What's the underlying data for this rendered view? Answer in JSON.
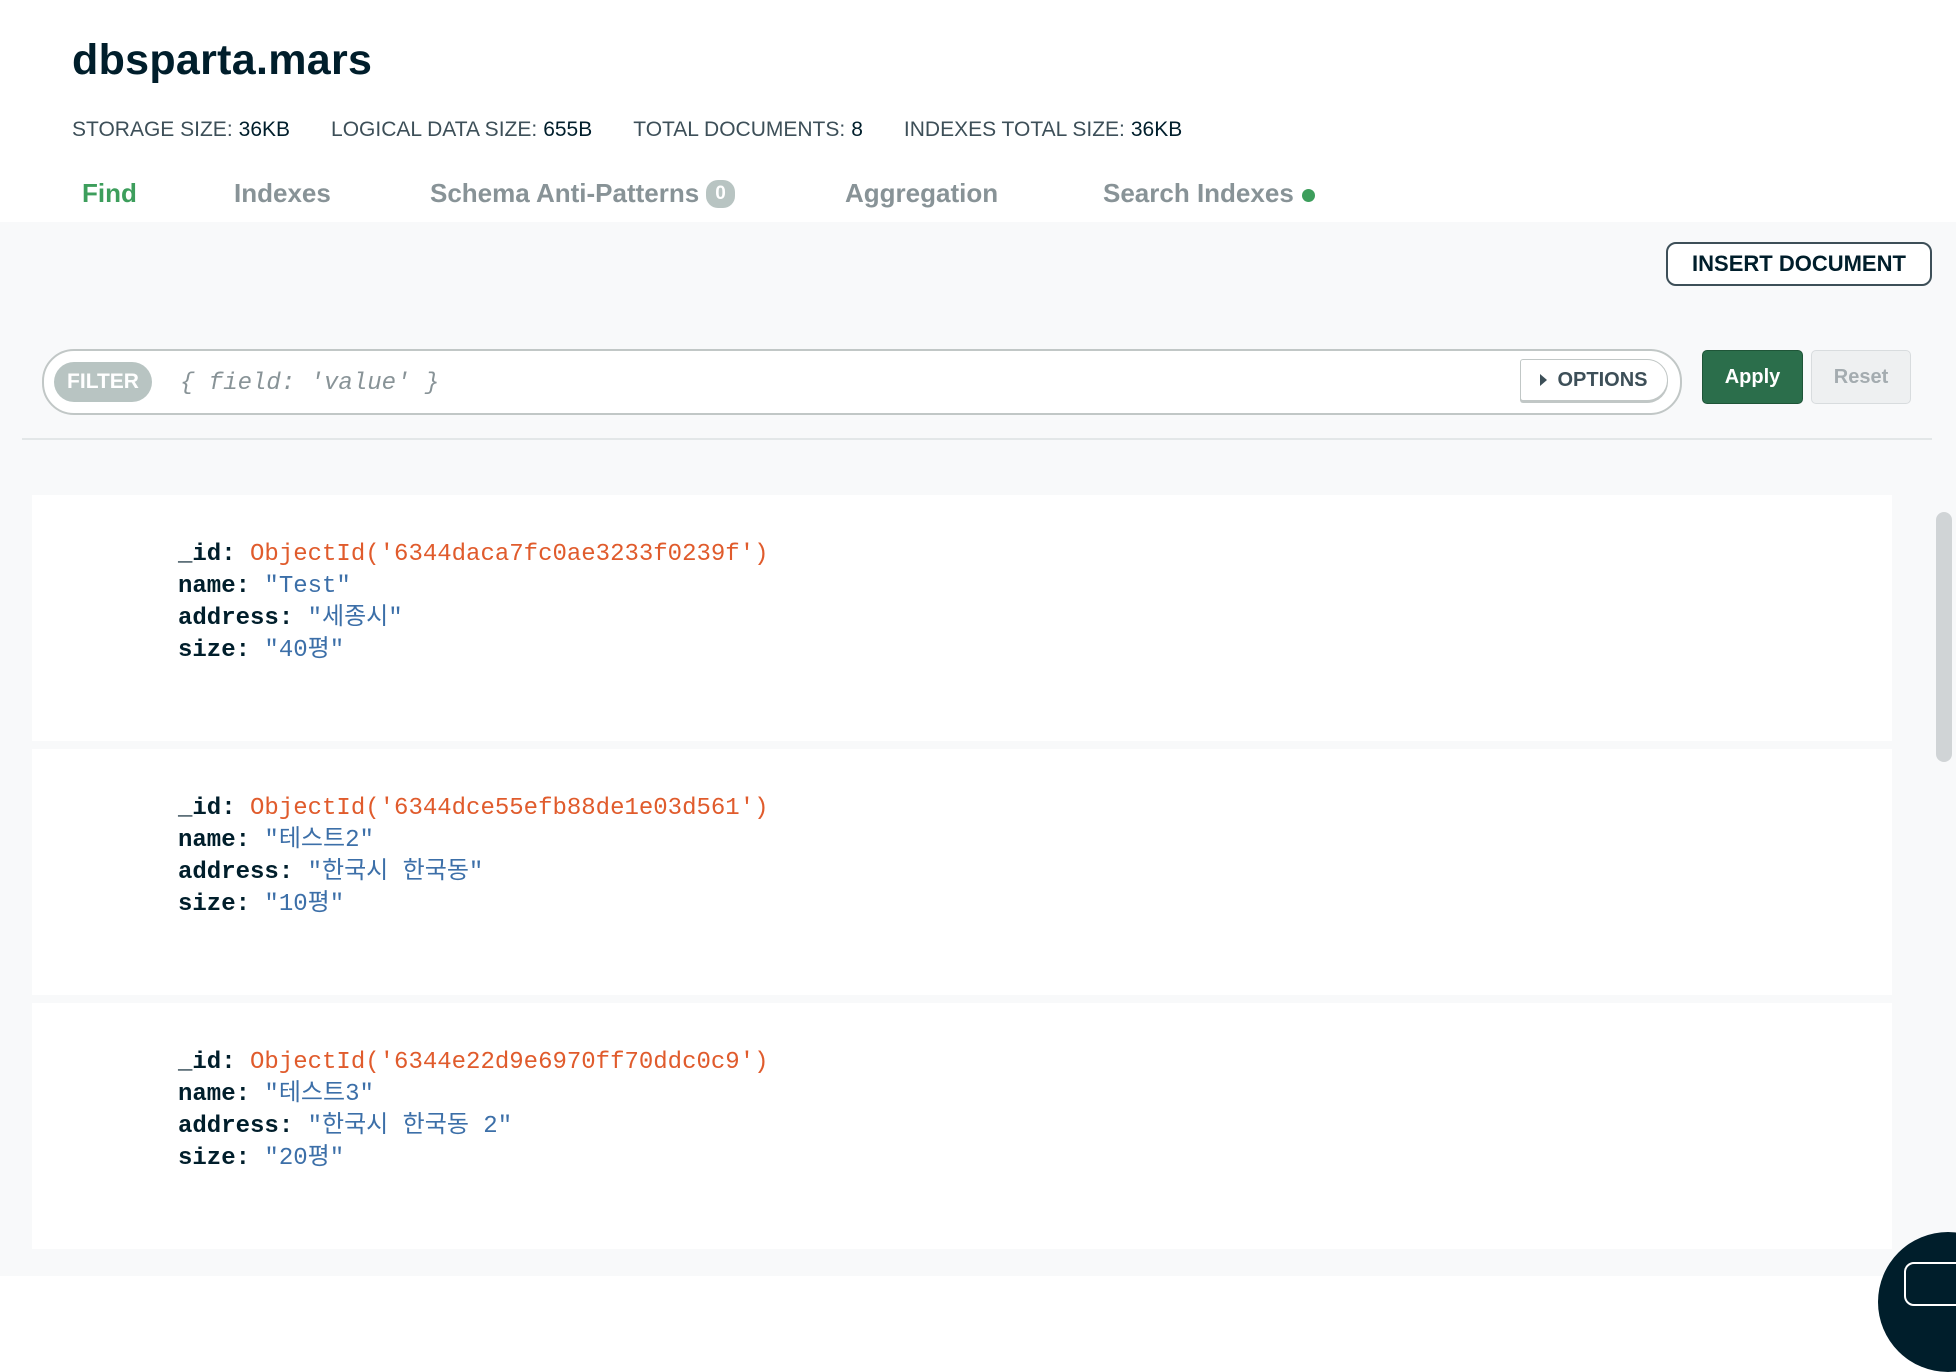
{
  "header": {
    "title": "dbsparta.mars",
    "stats": [
      {
        "label": "STORAGE SIZE:",
        "value": "36KB"
      },
      {
        "label": "LOGICAL DATA SIZE:",
        "value": "655B"
      },
      {
        "label": "TOTAL DOCUMENTS:",
        "value": "8"
      },
      {
        "label": "INDEXES TOTAL SIZE:",
        "value": "36KB"
      }
    ]
  },
  "tabs": [
    {
      "label": "Find",
      "active": true
    },
    {
      "label": "Indexes"
    },
    {
      "label": "Schema Anti-Patterns",
      "badge": "0"
    },
    {
      "label": "Aggregation"
    },
    {
      "label": "Search Indexes"
    }
  ],
  "toolbar": {
    "insert_label": "INSERT DOCUMENT",
    "filter_label": "FILTER",
    "filter_placeholder": "{ field: 'value' }",
    "options_label": "OPTIONS",
    "apply_label": "Apply",
    "reset_label": "Reset"
  },
  "documents": [
    {
      "id": "ObjectId('6344daca7fc0ae3233f0239f')",
      "name": "\"Test\"",
      "address": "\"세종시\"",
      "size": "\"40평\""
    },
    {
      "id": "ObjectId('6344dce55efb88de1e03d561')",
      "name": "\"테스트2\"",
      "address": "\"한국시 한국동\"",
      "size": "\"10평\""
    },
    {
      "id": "ObjectId('6344e22d9e6970ff70ddc0c9')",
      "name": "\"테스트3\"",
      "address": "\"한국시 한국동 2\"",
      "size": "\"20평\""
    }
  ],
  "field_keys": {
    "id": "_id:",
    "name": "name:",
    "address": "address:",
    "size": "size:"
  },
  "colors": {
    "accent_green": "#3d9e5c",
    "apply_green": "#2b6e4b",
    "object_id": "#e05b2c",
    "string_value": "#3c6fa8"
  }
}
